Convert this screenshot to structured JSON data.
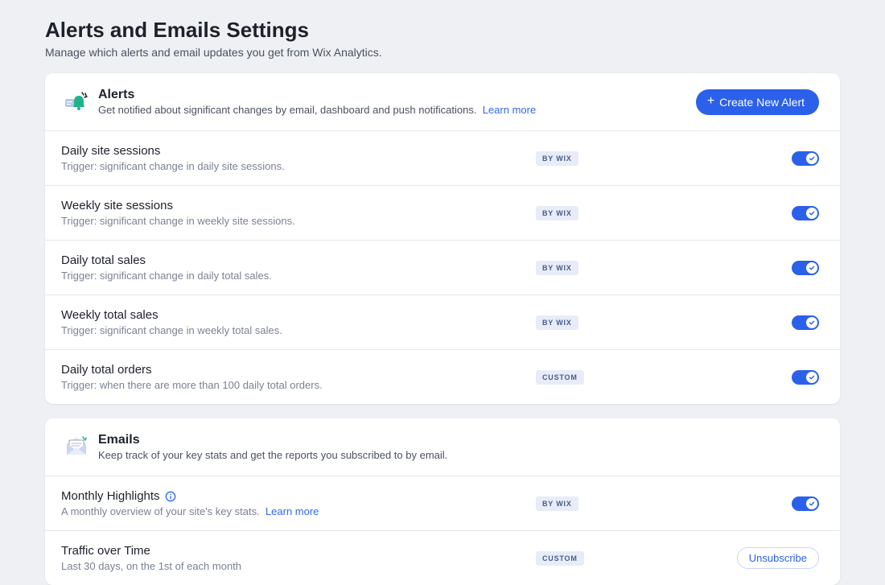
{
  "header": {
    "title": "Alerts and Emails Settings",
    "subtitle": "Manage which alerts and email updates you get from Wix Analytics."
  },
  "alerts_section": {
    "title": "Alerts",
    "description": "Get notified about significant changes by email, dashboard and push notifications.",
    "learn_more": "Learn more",
    "create_button": "Create New Alert",
    "items": [
      {
        "title": "Daily site sessions",
        "trigger": "Trigger: significant change in daily site sessions.",
        "badge": "BY WIX",
        "toggled_on": true
      },
      {
        "title": "Weekly site sessions",
        "trigger": "Trigger: significant change in weekly site sessions.",
        "badge": "BY WIX",
        "toggled_on": true
      },
      {
        "title": "Daily total sales",
        "trigger": "Trigger: significant change in daily total sales.",
        "badge": "BY WIX",
        "toggled_on": true
      },
      {
        "title": "Weekly total sales",
        "trigger": "Trigger: significant change in weekly total sales.",
        "badge": "BY WIX",
        "toggled_on": true
      },
      {
        "title": "Daily total orders",
        "trigger": "Trigger: when there are more than 100 daily total orders.",
        "badge": "CUSTOM",
        "toggled_on": true
      }
    ]
  },
  "emails_section": {
    "title": "Emails",
    "description": "Keep track of your key stats and get the reports you subscribed to by email.",
    "items": [
      {
        "title": "Monthly Highlights",
        "sub": "A monthly overview of your site's key stats.",
        "learn_more": "Learn more",
        "badge": "BY WIX",
        "control": "toggle",
        "info_icon": true
      },
      {
        "title": "Traffic over Time",
        "sub": "Last 30 days, on the 1st of each month",
        "badge": "CUSTOM",
        "control": "unsubscribe",
        "button_label": "Unsubscribe"
      }
    ]
  }
}
